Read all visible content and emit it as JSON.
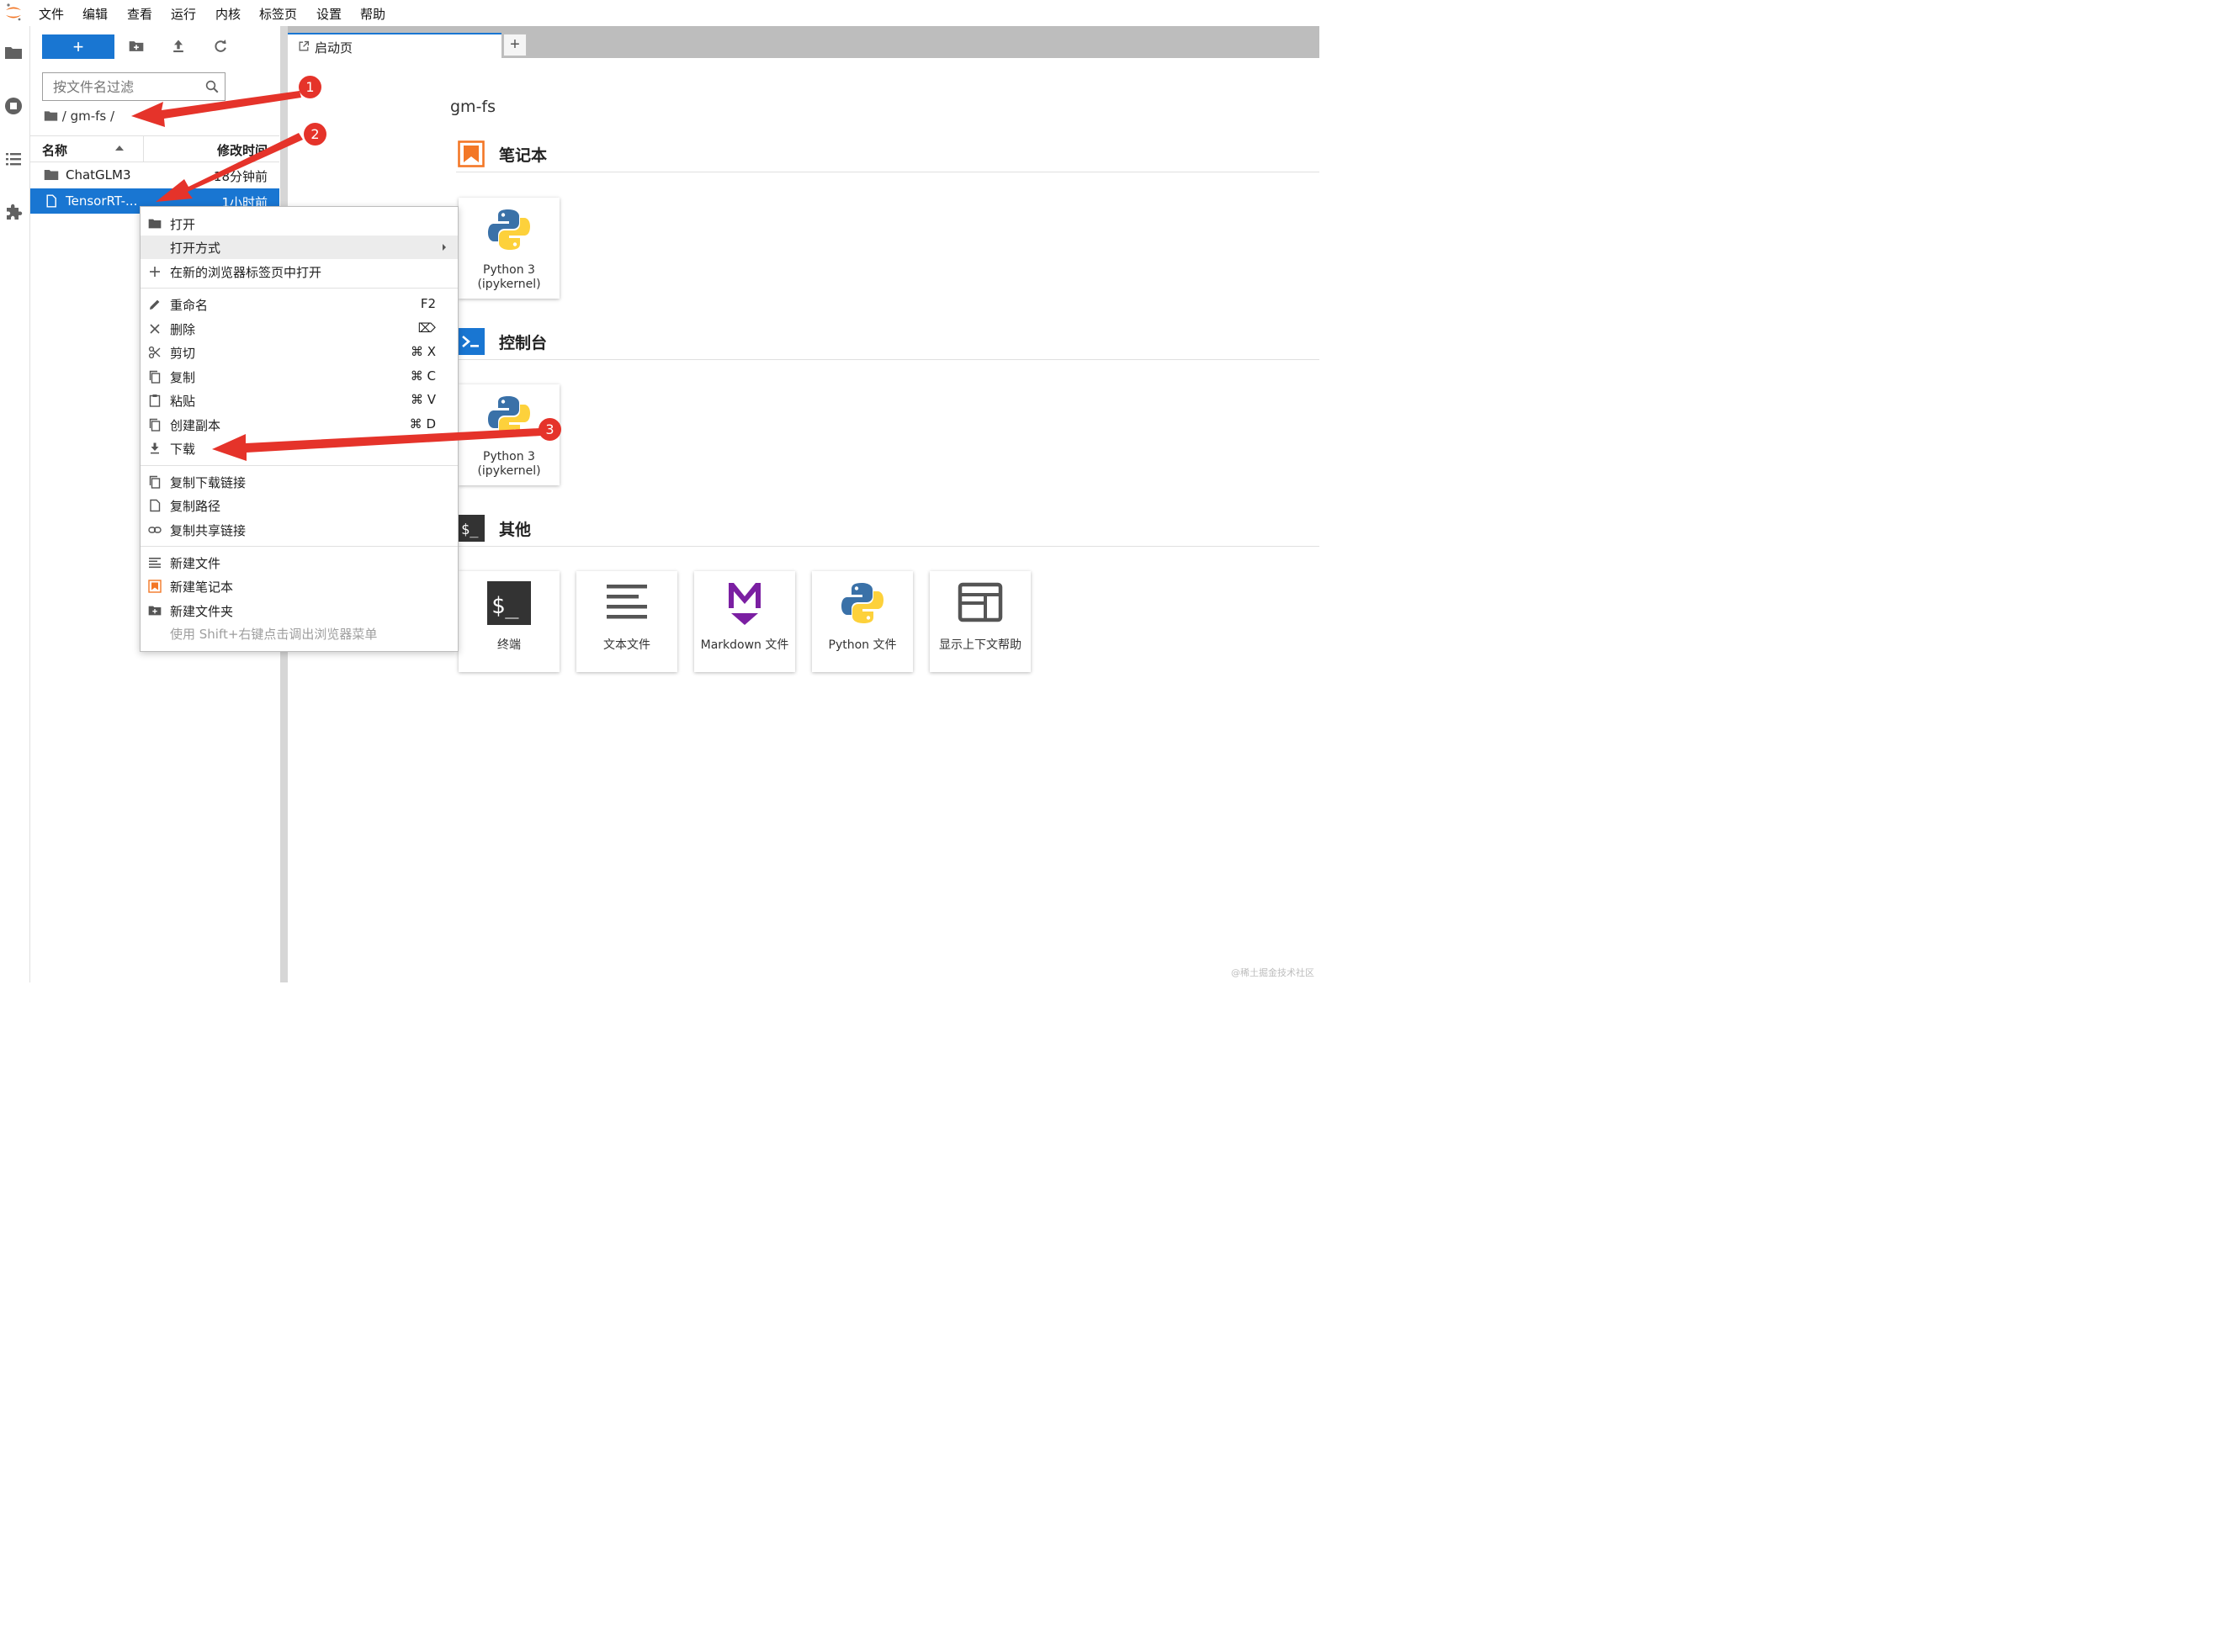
{
  "menubar": {
    "items": [
      "文件",
      "编辑",
      "查看",
      "运行",
      "内核",
      "标签页",
      "设置",
      "帮助"
    ]
  },
  "filebrowser": {
    "new_label": "+",
    "filter_placeholder": "按文件名过滤",
    "breadcrumb": "/ gm-fs /",
    "columns": {
      "name": "名称",
      "modified": "修改时间"
    },
    "rows": [
      {
        "name": "ChatGLM3",
        "time": "18分钟前",
        "kind": "folder"
      },
      {
        "name": "TensorRT-...",
        "time": "1小时前",
        "kind": "file"
      }
    ]
  },
  "tabs": {
    "launcher_label": "启动页",
    "add_label": "+"
  },
  "launcher": {
    "path": "gm-fs",
    "sections": {
      "notebook": {
        "title": "笔记本",
        "cards": [
          {
            "label": "Python 3 (ipykernel)"
          }
        ]
      },
      "console": {
        "title": "控制台",
        "cards": [
          {
            "label": "Python 3 (ipykernel)"
          }
        ]
      },
      "other": {
        "title": "其他",
        "cards": [
          {
            "label": "终端"
          },
          {
            "label": "文本文件"
          },
          {
            "label": "Markdown 文件"
          },
          {
            "label": "Python 文件"
          },
          {
            "label": "显示上下文帮助"
          }
        ]
      }
    }
  },
  "context_menu": {
    "items": [
      {
        "label": "打开",
        "shortcut": ""
      },
      {
        "label": "打开方式",
        "shortcut": ""
      },
      {
        "label": "在新的浏览器标签页中打开",
        "shortcut": ""
      },
      {
        "label": "重命名",
        "shortcut": "F2"
      },
      {
        "label": "删除",
        "shortcut": "⌦"
      },
      {
        "label": "剪切",
        "shortcut": "⌘ X"
      },
      {
        "label": "复制",
        "shortcut": "⌘ C"
      },
      {
        "label": "粘贴",
        "shortcut": "⌘ V"
      },
      {
        "label": "创建副本",
        "shortcut": "⌘ D"
      },
      {
        "label": "下载",
        "shortcut": ""
      },
      {
        "label": "复制下载链接",
        "shortcut": ""
      },
      {
        "label": "复制路径",
        "shortcut": ""
      },
      {
        "label": "复制共享链接",
        "shortcut": ""
      },
      {
        "label": "新建文件",
        "shortcut": ""
      },
      {
        "label": "新建笔记本",
        "shortcut": ""
      },
      {
        "label": "新建文件夹",
        "shortcut": ""
      }
    ],
    "hint": "使用 Shift+右键点击调出浏览器菜单"
  },
  "annotations": {
    "badges": [
      "1",
      "2",
      "3"
    ],
    "arrow_color": "#e5332a"
  },
  "colors": {
    "accent": "#1976d2",
    "notebook_icon": "#f37726",
    "markdown_icon": "#7b1fa2"
  },
  "watermark": "@稀土掘金技术社区"
}
